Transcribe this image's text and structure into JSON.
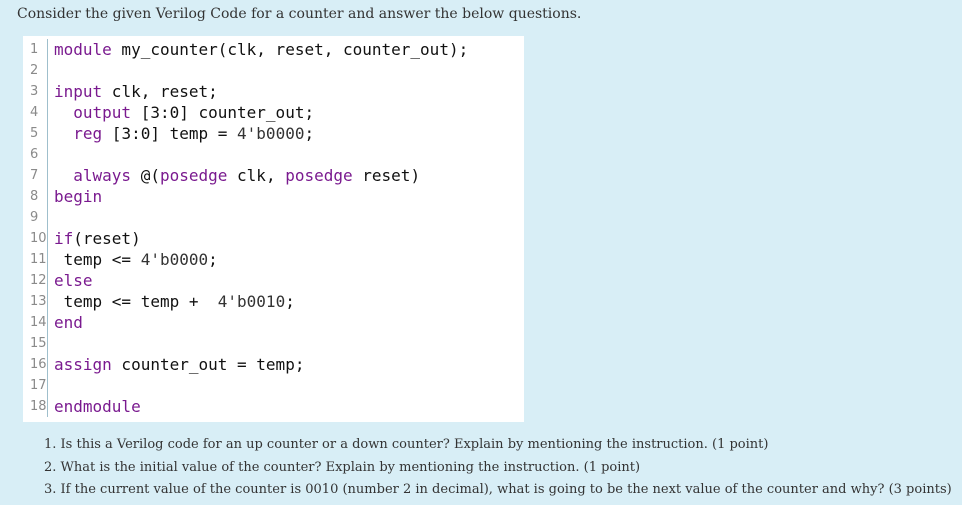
{
  "intro": "Consider the given Verilog Code for a counter and answer the below questions.",
  "code": [
    {
      "n": "1",
      "parts": [
        {
          "t": "module",
          "k": "kw"
        },
        {
          "t": " my_counter(clk, reset, counter_out);",
          "k": ""
        }
      ]
    },
    {
      "n": "2",
      "parts": []
    },
    {
      "n": "3",
      "parts": [
        {
          "t": "input",
          "k": "kw"
        },
        {
          "t": " clk, reset;",
          "k": ""
        }
      ]
    },
    {
      "n": "4",
      "parts": [
        {
          "t": "  ",
          "k": ""
        },
        {
          "t": "output",
          "k": "kw"
        },
        {
          "t": " [3:0] counter_out;",
          "k": ""
        }
      ]
    },
    {
      "n": "5",
      "parts": [
        {
          "t": "  ",
          "k": ""
        },
        {
          "t": "reg",
          "k": "kw"
        },
        {
          "t": " [3:0] temp = ",
          "k": ""
        },
        {
          "t": "4'b0000",
          "k": "num"
        },
        {
          "t": ";",
          "k": ""
        }
      ]
    },
    {
      "n": "6",
      "parts": []
    },
    {
      "n": "7",
      "parts": [
        {
          "t": "  ",
          "k": ""
        },
        {
          "t": "always",
          "k": "kw"
        },
        {
          "t": " @(",
          "k": ""
        },
        {
          "t": "posedge",
          "k": "kw"
        },
        {
          "t": " clk, ",
          "k": ""
        },
        {
          "t": "posedge",
          "k": "kw"
        },
        {
          "t": " reset)",
          "k": ""
        }
      ]
    },
    {
      "n": "8",
      "parts": [
        {
          "t": "begin",
          "k": "kw"
        }
      ]
    },
    {
      "n": "9",
      "parts": []
    },
    {
      "n": "10",
      "parts": [
        {
          "t": "if",
          "k": "kw"
        },
        {
          "t": "(reset)",
          "k": ""
        }
      ]
    },
    {
      "n": "11",
      "parts": [
        {
          "t": " temp <= ",
          "k": ""
        },
        {
          "t": "4'b0000",
          "k": "num"
        },
        {
          "t": ";",
          "k": ""
        }
      ]
    },
    {
      "n": "12",
      "parts": [
        {
          "t": "else",
          "k": "kw"
        }
      ]
    },
    {
      "n": "13",
      "parts": [
        {
          "t": " temp <= temp +  ",
          "k": ""
        },
        {
          "t": "4'b0010",
          "k": "num"
        },
        {
          "t": ";",
          "k": ""
        }
      ]
    },
    {
      "n": "14",
      "parts": [
        {
          "t": "end",
          "k": "kw"
        }
      ]
    },
    {
      "n": "15",
      "parts": []
    },
    {
      "n": "16",
      "parts": [
        {
          "t": "assign",
          "k": "kw"
        },
        {
          "t": " counter_out = temp;",
          "k": ""
        }
      ]
    },
    {
      "n": "17",
      "parts": []
    },
    {
      "n": "18",
      "parts": [
        {
          "t": "endmodule",
          "k": "kw"
        }
      ]
    }
  ],
  "questions": [
    "1. Is this a Verilog code for an up counter or a down counter? Explain by mentioning the instruction. (1 point)",
    "2. What is the initial value of the counter? Explain by mentioning the instruction. (1 point)",
    "3. If the current value of the counter is 0010 (number 2 in decimal), what is going to be the next value of the counter and why? (3 points)"
  ]
}
